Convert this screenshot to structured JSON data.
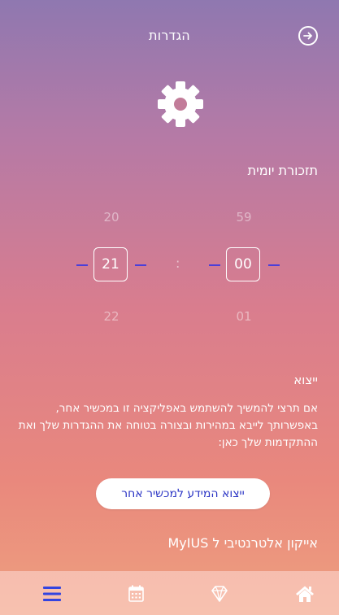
{
  "header": {
    "title": "הגדרות",
    "back_icon": "arrow-right-circle-icon"
  },
  "settings_icon": "gear-icon",
  "daily_reminder": {
    "title": "תזכורת יומית",
    "hours": {
      "prev": "20",
      "current": "21",
      "next": "22"
    },
    "separator": ":",
    "minutes": {
      "prev": "59",
      "current": "00",
      "next": "01"
    }
  },
  "export": {
    "title": "ייצוא",
    "description": "אם תרצי להמשיך להשתמש באפליקציה זו במכשיר אחר, באפשרותך לייבא במהירות ובצורה בטוחה את ההגדרות שלך ואת ההתקדמות שלך כאן:",
    "button_label": "ייצוא המידע למכשיר אחר"
  },
  "alternative_icon": {
    "title": "אייקון אלטרנטיבי ל MyIUS"
  },
  "bottom_nav": {
    "items": [
      {
        "icon": "menu-icon",
        "active": true
      },
      {
        "icon": "calendar-icon",
        "active": false
      },
      {
        "icon": "diamond-icon",
        "active": false
      },
      {
        "icon": "home-icon",
        "active": false
      }
    ]
  },
  "colors": {
    "accent": "#2b35c5",
    "nav_active": "#3344e0",
    "dash": "#4b3fd9"
  }
}
